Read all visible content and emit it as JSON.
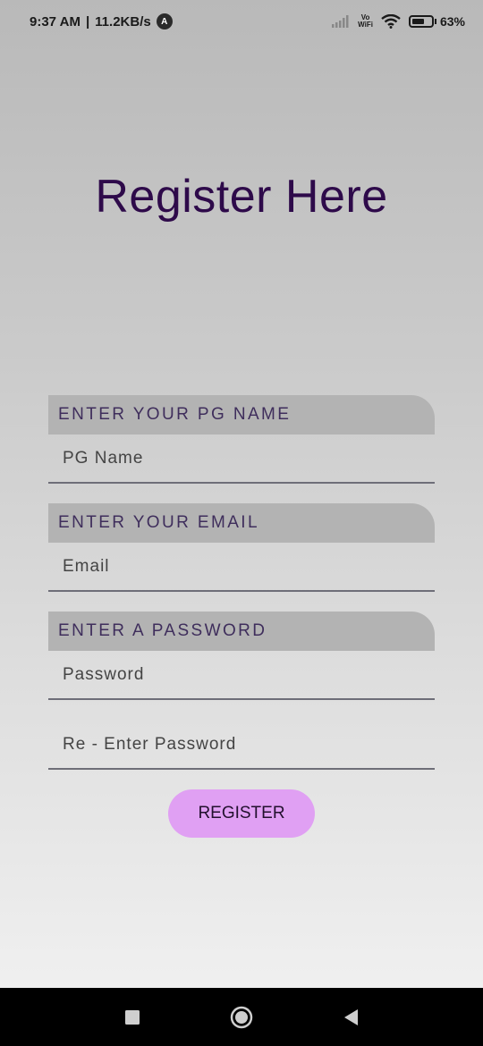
{
  "status_bar": {
    "time": "9:37 AM",
    "speed": "11.2KB/s",
    "app_badge": "A",
    "volte_top": "Vo",
    "volte_bottom": "WiFi",
    "battery_level": 0.63,
    "battery_text": "63%"
  },
  "title": "Register Here",
  "form": {
    "pg_name": {
      "header": "ENTER YOUR PG NAME",
      "placeholder": "PG Name"
    },
    "email": {
      "header": "ENTER YOUR EMAIL",
      "placeholder": "Email"
    },
    "password": {
      "header": "ENTER A PASSWORD",
      "placeholder": "Password"
    },
    "confirm_password": {
      "placeholder": "Re - Enter Password"
    },
    "submit_label": "REGISTER"
  },
  "colors": {
    "title": "#2e0a4a",
    "button": "#e0a0f3",
    "header_band": "#b3b3b3"
  },
  "nav": [
    "recents-icon",
    "home-icon",
    "back-icon"
  ]
}
